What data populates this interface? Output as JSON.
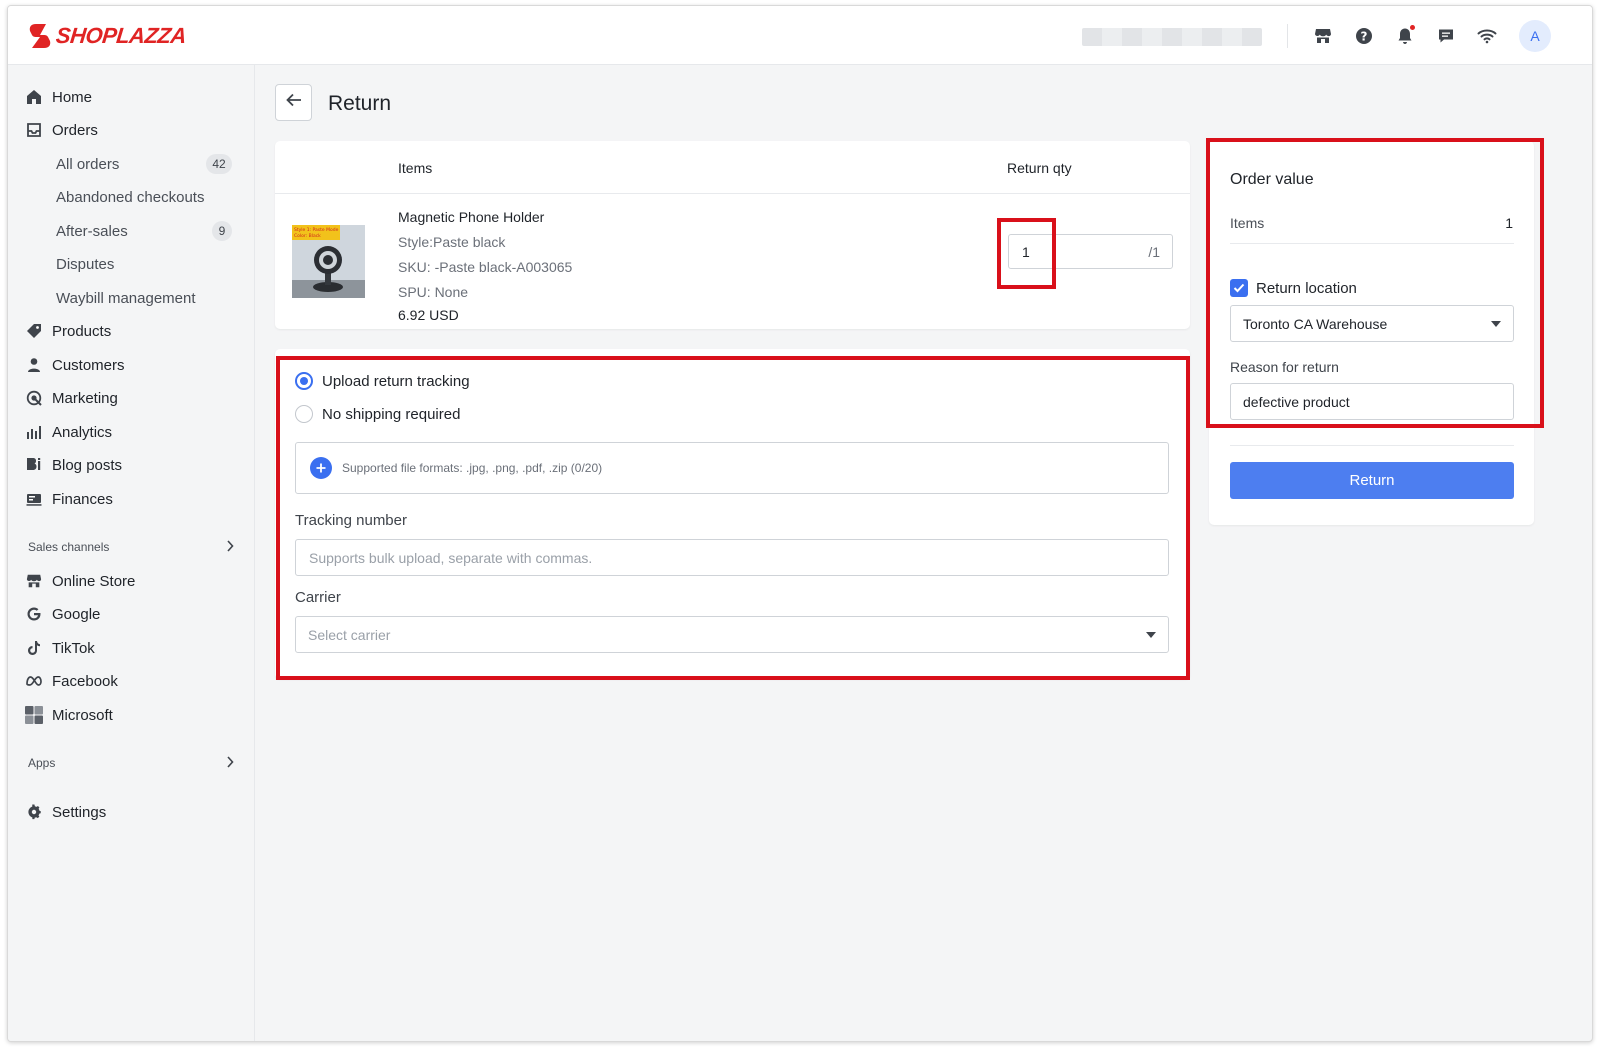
{
  "brand": {
    "name": "SHOPLAZZA",
    "color": "#e02424"
  },
  "topbar": {
    "icons": [
      "store-icon",
      "help-icon",
      "bell-icon",
      "chat-icon",
      "wifi-icon"
    ],
    "avatar_initial": "A"
  },
  "sidebar": {
    "home": "Home",
    "orders": "Orders",
    "all_orders": "All orders",
    "all_orders_count": "42",
    "abandoned_checkouts": "Abandoned checkouts",
    "after_sales": "After-sales",
    "after_sales_count": "9",
    "disputes": "Disputes",
    "waybill_management": "Waybill management",
    "products": "Products",
    "customers": "Customers",
    "marketing": "Marketing",
    "analytics": "Analytics",
    "blog_posts": "Blog posts",
    "finances": "Finances",
    "sales_channels": "Sales channels",
    "online_store": "Online Store",
    "google": "Google",
    "tiktok": "TikTok",
    "facebook": "Facebook",
    "microsoft": "Microsoft",
    "apps": "Apps",
    "settings": "Settings"
  },
  "page": {
    "title": "Return"
  },
  "items_table": {
    "col_items": "Items",
    "col_return_qty": "Return qty",
    "product": {
      "thumb_line1": "Style 1: Paste Mode",
      "thumb_line2": "Color: Black",
      "name": "Magnetic Phone Holder",
      "style": "Style:Paste black",
      "sku": "SKU: -Paste black-A003065",
      "spu": "SPU: None",
      "price": "6.92 USD",
      "return_qty": "1",
      "max_qty": "/1"
    }
  },
  "tracking": {
    "option_upload": "Upload return tracking",
    "option_no_shipping": "No shipping required",
    "upload_hint": "Supported file formats: .jpg, .png, .pdf, .zip (0/20)",
    "tracking_label": "Tracking number",
    "tracking_placeholder": "Supports bulk upload, separate with commas.",
    "carrier_label": "Carrier",
    "carrier_placeholder": "Select carrier"
  },
  "order_value": {
    "title": "Order value",
    "items_label": "Items",
    "items_value": "1",
    "return_location_label": "Return location",
    "return_location_checked": true,
    "location_value": "Toronto CA Warehouse",
    "reason_label": "Reason for return",
    "reason_value": "defective product",
    "return_button": "Return"
  },
  "colors": {
    "accent": "#3a6ff0",
    "primary_button": "#4d7ef0",
    "highlight": "#d9101a"
  }
}
